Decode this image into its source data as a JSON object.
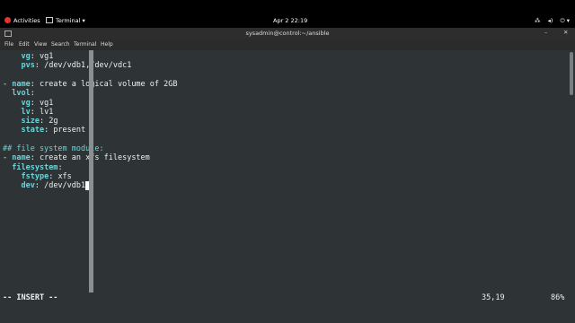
{
  "topbar": {
    "activities": "Activities",
    "app_menu": "Terminal ▾",
    "clock": "Apr 2  22:19",
    "system_icons": [
      "network-icon",
      "volume-icon",
      "power-icon"
    ]
  },
  "window": {
    "title": "sysadmin@control:~/ansible"
  },
  "menu": [
    "File",
    "Edit",
    "View",
    "Search",
    "Terminal",
    "Help"
  ],
  "editor": {
    "lines": [
      [
        {
          "t": "    "
        },
        {
          "t": "vg",
          "c": "key"
        },
        {
          "t": ": vg1"
        }
      ],
      [
        {
          "t": "    "
        },
        {
          "t": "pvs",
          "c": "key"
        },
        {
          "t": ": /dev/vdb1,/dev/vdc1"
        }
      ],
      [],
      [
        {
          "t": "- "
        },
        {
          "t": "name",
          "c": "key"
        },
        {
          "t": ": create a logical volume of 2GB"
        }
      ],
      [
        {
          "t": "  "
        },
        {
          "t": "lvol",
          "c": "key"
        },
        {
          "t": ":"
        }
      ],
      [
        {
          "t": "    "
        },
        {
          "t": "vg",
          "c": "key"
        },
        {
          "t": ": vg1"
        }
      ],
      [
        {
          "t": "    "
        },
        {
          "t": "lv",
          "c": "key"
        },
        {
          "t": ": lv1"
        }
      ],
      [
        {
          "t": "    "
        },
        {
          "t": "size",
          "c": "key"
        },
        {
          "t": ": 2g"
        }
      ],
      [
        {
          "t": "    "
        },
        {
          "t": "state",
          "c": "key"
        },
        {
          "t": ": present"
        }
      ],
      [],
      [
        {
          "t": "## file system module:",
          "c": "comment"
        }
      ],
      [
        {
          "t": "- "
        },
        {
          "t": "name",
          "c": "key"
        },
        {
          "t": ": create an xfs filesystem"
        }
      ],
      [
        {
          "t": "  "
        },
        {
          "t": "filesystem",
          "c": "key"
        },
        {
          "t": ":"
        }
      ],
      [
        {
          "t": "    "
        },
        {
          "t": "fstype",
          "c": "key"
        },
        {
          "t": ": xfs"
        }
      ],
      [
        {
          "t": "    "
        },
        {
          "t": "dev",
          "c": "key"
        },
        {
          "t": ": /dev/vdb1"
        },
        {
          "t": " ",
          "c": "cursor"
        }
      ]
    ]
  },
  "status": {
    "mode": "-- INSERT --",
    "position": "35,19",
    "percent": "86%"
  },
  "colors": {
    "editor_bg": "#2e3436",
    "key": "#6cd3d8"
  }
}
